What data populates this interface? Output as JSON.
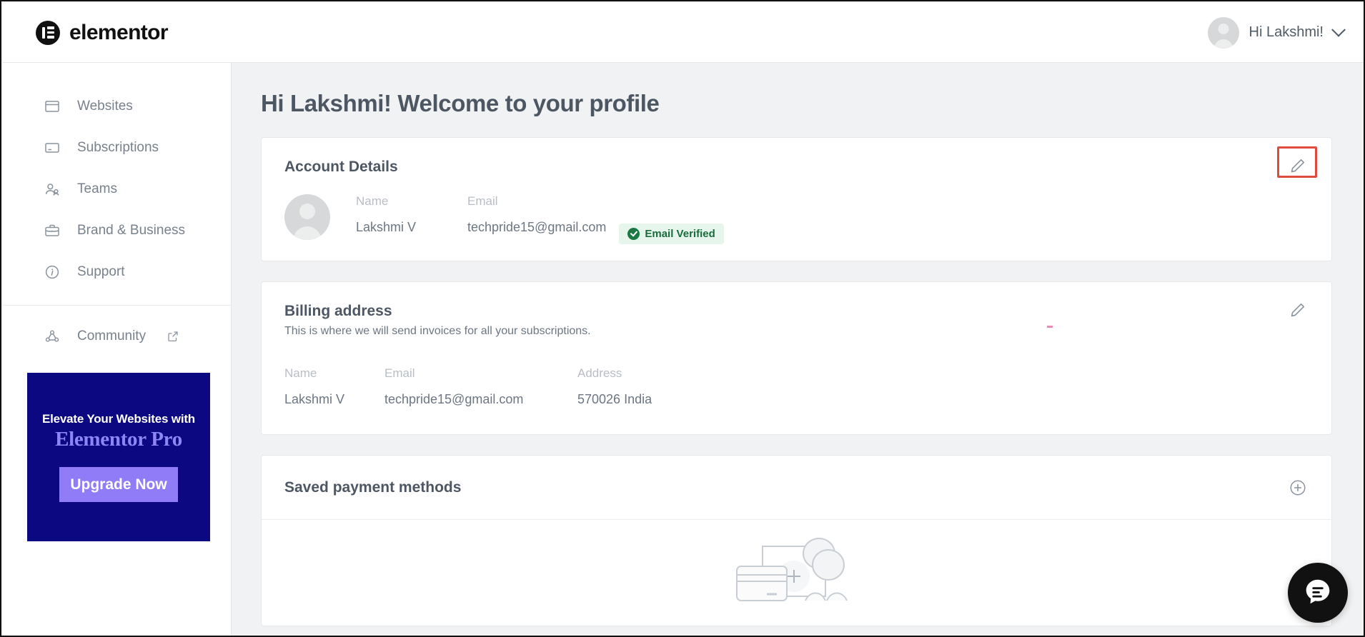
{
  "header": {
    "brand": "elementor",
    "brand_icon": "elementor-logo-icon",
    "user_greeting": "Hi Lakshmi!",
    "avatar_icon": "user-avatar-icon",
    "chevron_icon": "chevron-down-icon"
  },
  "sidebar": {
    "items": [
      {
        "label": "Websites",
        "icon": "browser-window-icon"
      },
      {
        "label": "Subscriptions",
        "icon": "subscription-card-icon"
      },
      {
        "label": "Teams",
        "icon": "people-icon"
      },
      {
        "label": "Brand & Business",
        "icon": "briefcase-icon"
      },
      {
        "label": "Support",
        "icon": "info-circle-icon"
      },
      {
        "label": "Community",
        "icon": "community-nodes-icon",
        "external_icon": "external-link-icon"
      }
    ],
    "promo": {
      "line1": "Elevate Your Websites with",
      "line2": "Elementor Pro",
      "button": "Upgrade Now",
      "bg_color": "#0b0882",
      "button_color": "#917cf8",
      "title_color": "#8d86f5"
    }
  },
  "main": {
    "page_title": "Hi Lakshmi! Welcome to your profile",
    "account_details": {
      "title": "Account Details",
      "edit_icon": "pencil-edit-icon",
      "avatar_icon": "user-avatar-icon",
      "name_label": "Name",
      "name_value": "Lakshmi V",
      "email_label": "Email",
      "email_value": "techpride15@gmail.com",
      "verified_badge": "Email Verified",
      "verified_icon": "check-circle-icon",
      "badge_bg": "#e6f6ec",
      "badge_fg": "#1b6b3d",
      "highlight_color": "#e14b3f"
    },
    "billing_address": {
      "title": "Billing address",
      "subtitle": "This is where we will send invoices for all your subscriptions.",
      "edit_icon": "pencil-edit-icon",
      "name_label": "Name",
      "name_value": "Lakshmi V",
      "email_label": "Email",
      "email_value": "techpride15@gmail.com",
      "address_label": "Address",
      "address_value": "570026  India"
    },
    "saved_payment_methods": {
      "title": "Saved payment methods",
      "add_icon": "plus-circle-icon",
      "empty_illustration": "credit-card-coins-illustration"
    }
  },
  "chat_widget": {
    "icon": "chat-bubble-icon",
    "bg_color": "#111111"
  }
}
